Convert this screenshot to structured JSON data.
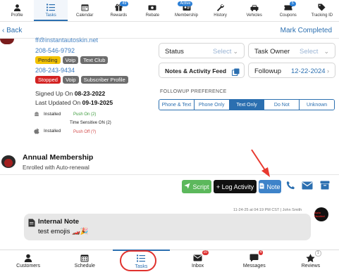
{
  "top_nav": {
    "items": [
      {
        "label": "Profile",
        "icon": "user-icon"
      },
      {
        "label": "Tasks",
        "icon": "list-icon",
        "active": true
      },
      {
        "label": "Calendar",
        "icon": "calendar-icon"
      },
      {
        "label": "Rewards",
        "icon": "gift-icon",
        "badge": "49"
      },
      {
        "label": "Rebate",
        "icon": "money-icon"
      },
      {
        "label": "Membership",
        "icon": "id-card-icon",
        "badge": "Active"
      },
      {
        "label": "History",
        "icon": "wrench-icon"
      },
      {
        "label": "Vehicles",
        "icon": "car-icon"
      },
      {
        "label": "Coupons",
        "icon": "coupon-icon",
        "badge": "5"
      },
      {
        "label": "Tracking ID",
        "icon": "tag-icon"
      }
    ]
  },
  "back_bar": {
    "back_label": "Back",
    "mark_completed": "Mark Completed"
  },
  "contact": {
    "email": "ff@instantautoskin.net",
    "phone1": "208-546-9792",
    "phone1_tags": [
      "Pending",
      "Voip",
      "Text Club"
    ],
    "phone2": "208-243-9434",
    "phone2_tags": [
      "Stopped",
      "Voip",
      "Subscriber Profile"
    ],
    "signed_up_label": "Signed Up On",
    "signed_up_date": "08-23-2022",
    "last_updated_label": "Last Updated On",
    "last_updated_date": "09-19-2025",
    "installs": [
      {
        "os": "android",
        "label": "Installed",
        "status": "Push On (2)"
      },
      {
        "os": "apple",
        "label": "Installed",
        "time_sensitive": "Time Sensitive ON (2)",
        "status": "Push Off (?)"
      }
    ]
  },
  "task_panel": {
    "status_label": "Status",
    "status_value": "Select",
    "owner_label": "Task Owner",
    "owner_value": "Select",
    "notes_label": "Notes & Activity Feed",
    "followup_label": "Followup",
    "followup_date": "12-22-2024",
    "preference_title": "FOLLOWUP PREFERENCE",
    "preference_options": [
      "Phone & Text",
      "Phone Only",
      "Text Only",
      "Do Not",
      "Unknown"
    ],
    "preference_selected": "Text Only"
  },
  "membership": {
    "title": "Annual Membership",
    "subtitle": "Enrolled with Auto-renewal"
  },
  "actions": {
    "script": "Script",
    "log_activity": "+ Log Activity",
    "note": "Note"
  },
  "message": {
    "meta": "11-24-25 at 04:19 PM CST | John Smith",
    "title": "Internal Note",
    "body": "test emojis 🏎️🎉",
    "avatar_text": "Auto Hustled"
  },
  "bottom_nav": {
    "items": [
      {
        "label": "Customers",
        "icon": "person-icon"
      },
      {
        "label": "Schedule",
        "icon": "calendar-icon"
      },
      {
        "label": "Tasks",
        "icon": "list-icon",
        "active": true
      },
      {
        "label": "Inbox",
        "icon": "envelope-icon",
        "badge": "10"
      },
      {
        "label": "Messages",
        "icon": "chat-icon",
        "badge": "4"
      },
      {
        "label": "Reviews",
        "icon": "star-icon",
        "badge": "1"
      }
    ]
  },
  "colors": {
    "accent": "#2b6fb0",
    "script_green": "#5cb85c",
    "note_blue": "#3e83c9",
    "highlight_red": "#e0312d"
  }
}
